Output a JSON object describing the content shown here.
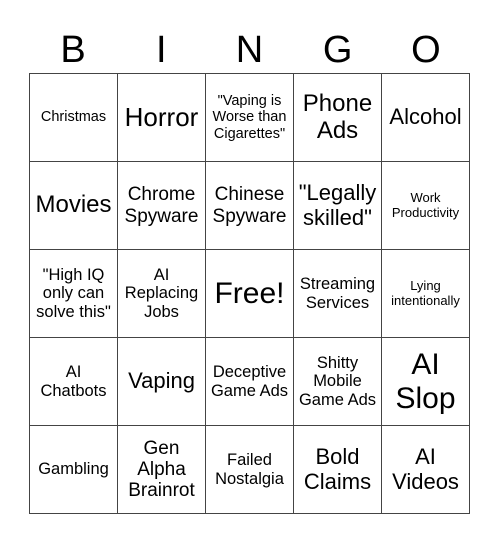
{
  "header": {
    "letters": [
      "B",
      "I",
      "N",
      "G",
      "O"
    ]
  },
  "board": {
    "rows": [
      [
        "Christmas",
        "Horror",
        "\"Vaping is Worse than Cigarettes\"",
        "Phone Ads",
        "Alcohol"
      ],
      [
        "Movies",
        "Chrome Spyware",
        "Chinese Spyware",
        "\"Legally skilled\"",
        "Work Productivity"
      ],
      [
        "\"High IQ only can solve this\"",
        "AI Replacing Jobs",
        "Free!",
        "Streaming Services",
        "Lying intentionally"
      ],
      [
        "AI Chatbots",
        "Vaping",
        "Deceptive Game Ads",
        "Shitty Mobile Game Ads",
        "AI Slop"
      ],
      [
        "Gambling",
        "Gen Alpha Brainrot",
        "Failed Nostalgia",
        "Bold Claims",
        "AI Videos"
      ]
    ]
  }
}
